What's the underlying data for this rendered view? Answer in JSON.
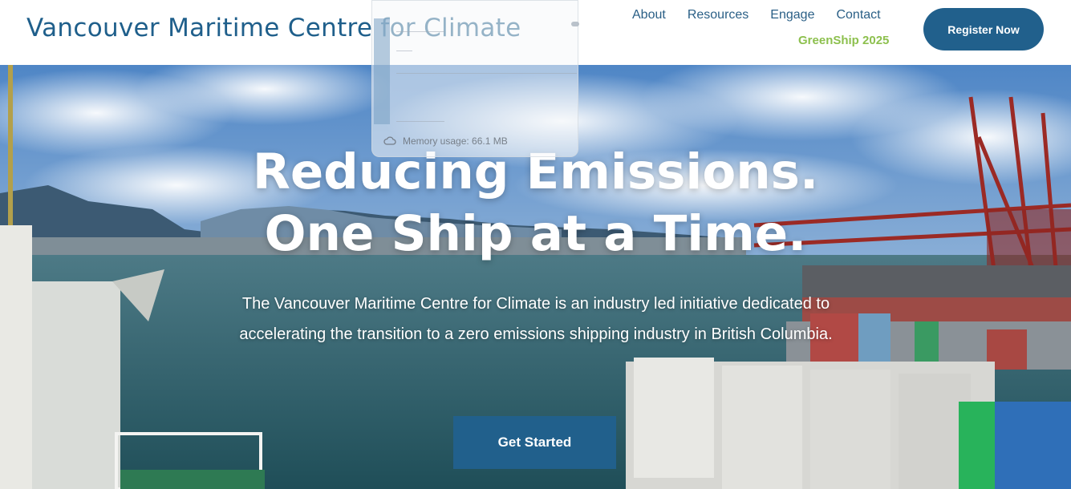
{
  "header": {
    "site_title": "Vancouver Maritime Centre for Climate",
    "nav": [
      "About",
      "Resources",
      "Engage",
      "Contact"
    ],
    "highlight_link": "GreenShip 2025",
    "register_label": "Register Now"
  },
  "overlay": {
    "memory_usage": "Memory usage: 66.1 MB",
    "icon": "cloud-icon"
  },
  "hero": {
    "headline_line1": "Reducing Emissions.",
    "headline_line2": "One Ship at a Time.",
    "description": "The Vancouver Maritime Centre for Climate is an industry led initiative dedicated to accelerating the transition to a zero emissions shipping industry in British Columbia.",
    "cta_label": "Get Started"
  },
  "colors": {
    "brand_blue": "#21608c",
    "accent_green": "#8dc04e",
    "title_blue": "#1f5f8b"
  }
}
